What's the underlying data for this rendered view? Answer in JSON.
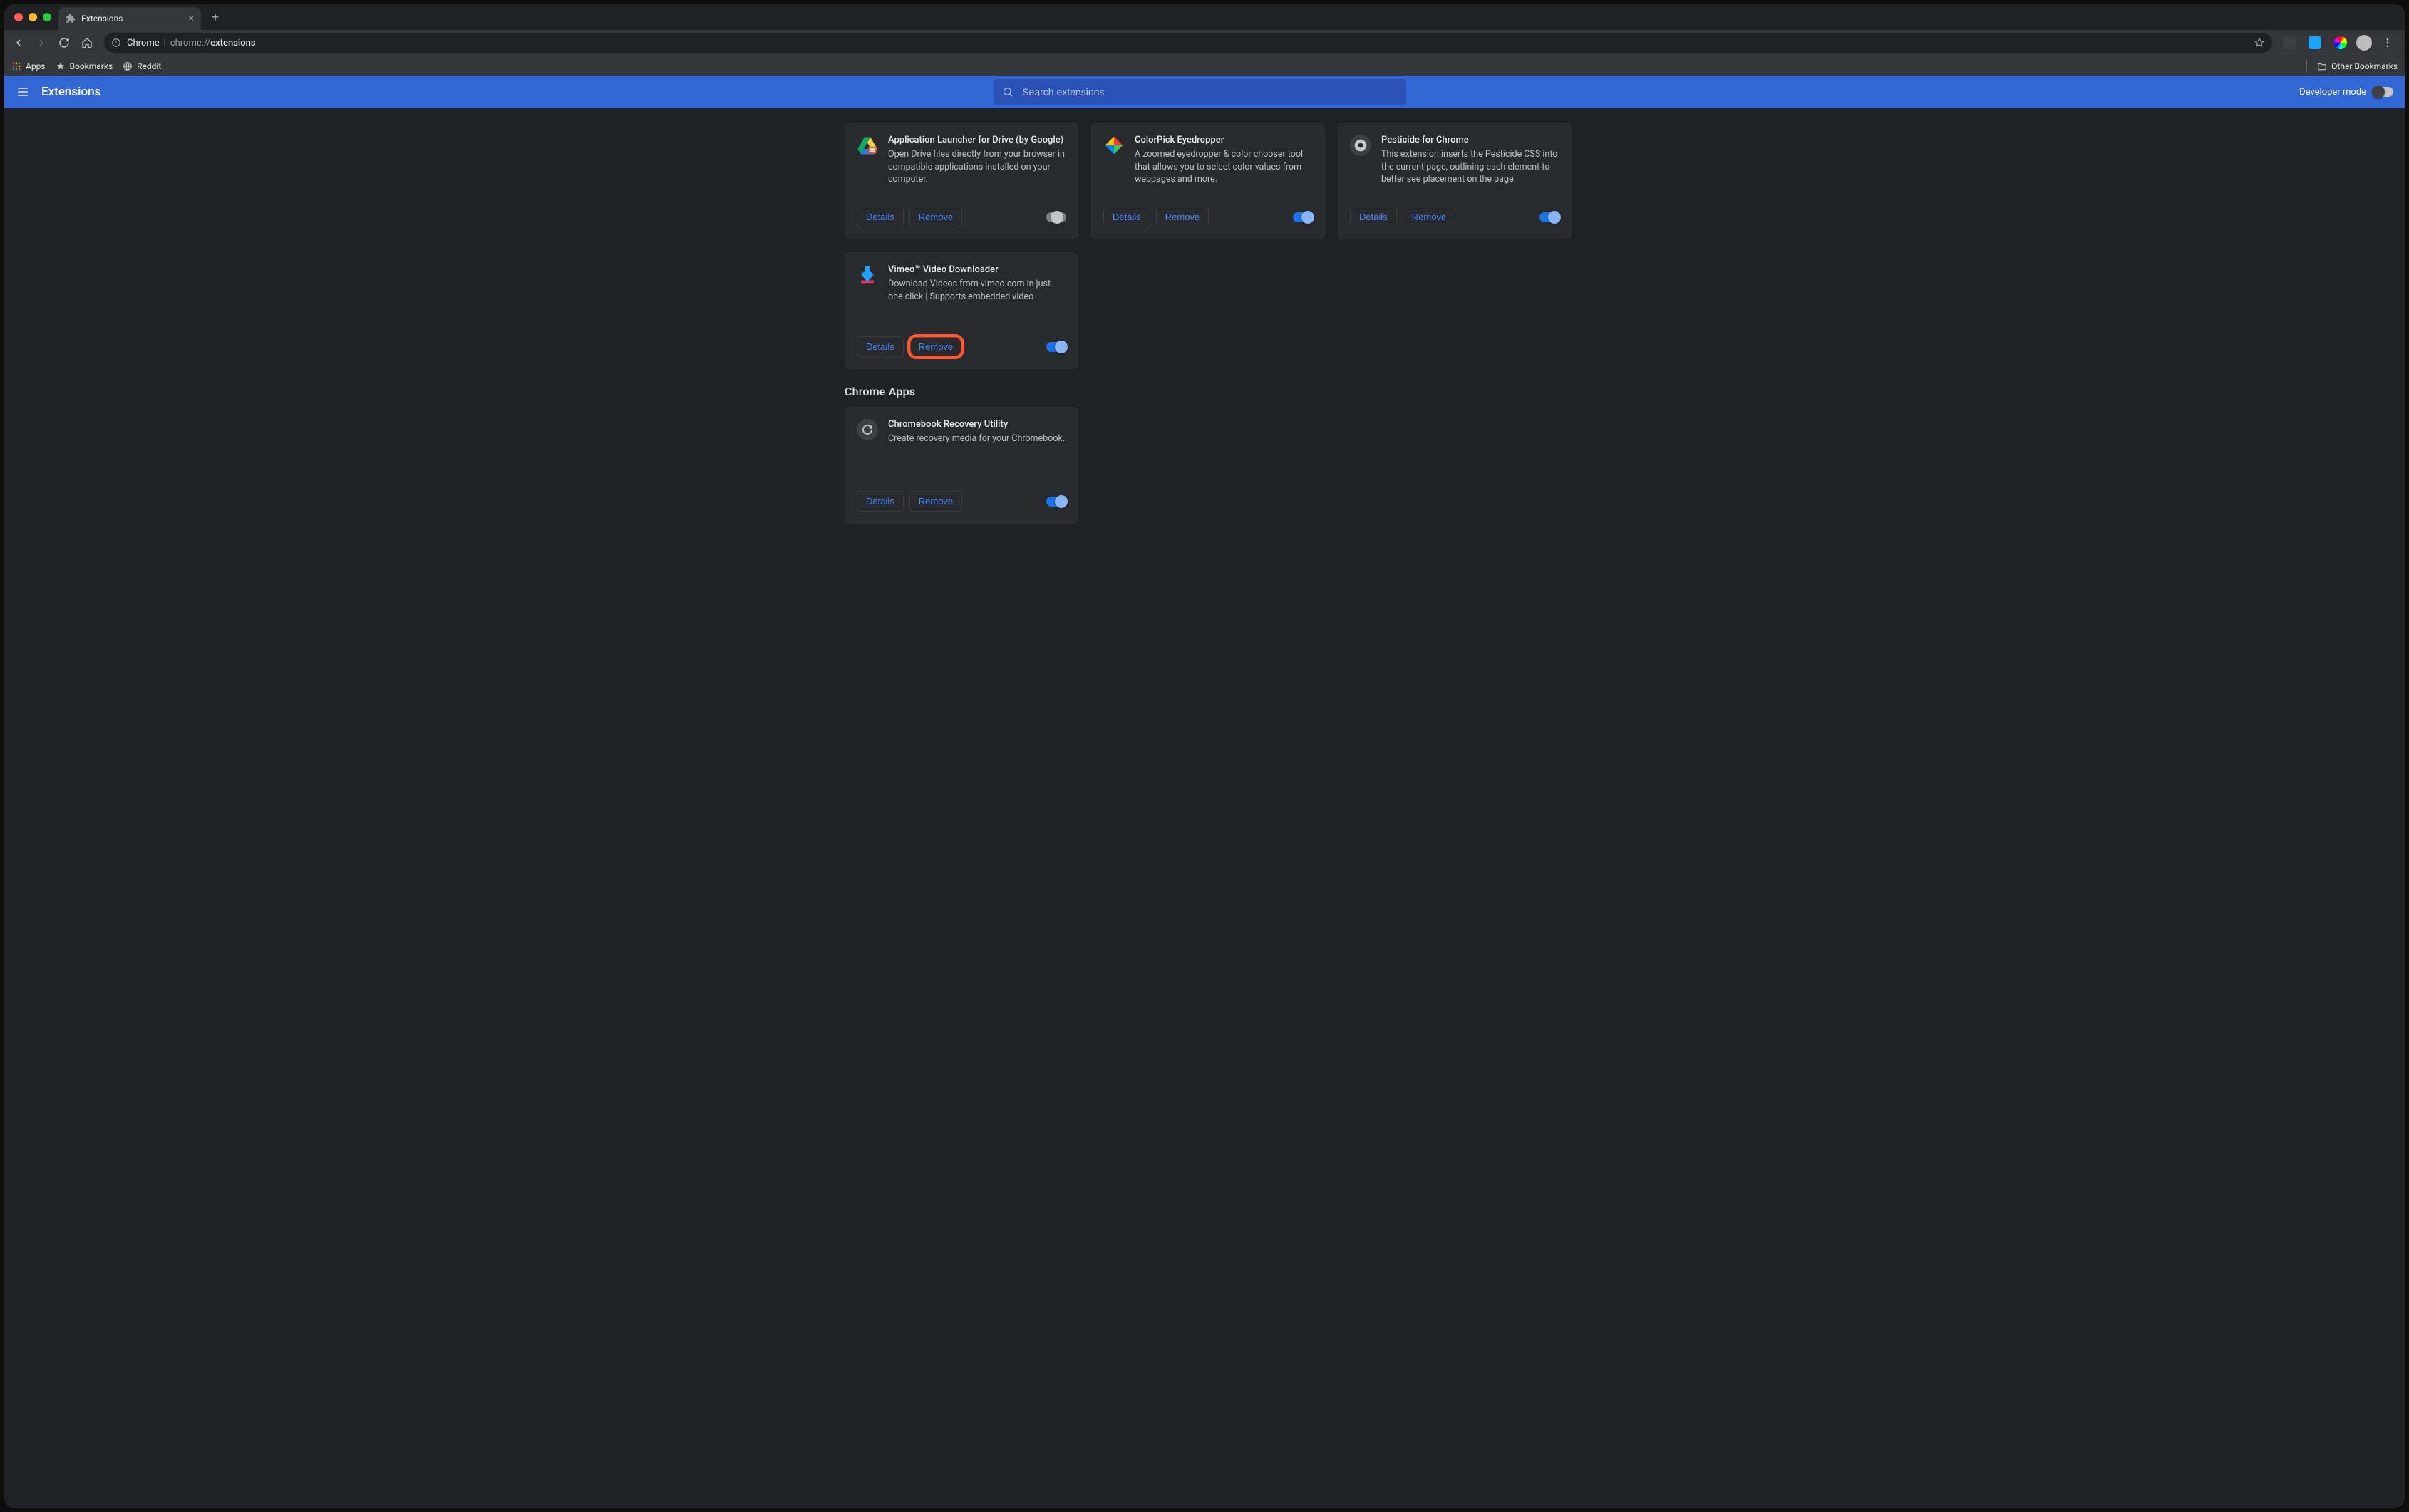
{
  "window": {
    "tab_title": "Extensions"
  },
  "omnibox": {
    "scheme_app": "Chrome",
    "url_prefix": "chrome://",
    "url_highlight": "extensions"
  },
  "bookmarks": {
    "apps": "Apps",
    "bookmarks_folder": "Bookmarks",
    "reddit": "Reddit",
    "other_bookmarks": "Other Bookmarks"
  },
  "header": {
    "title": "Extensions",
    "search_placeholder": "Search extensions",
    "developer_mode_label": "Developer mode"
  },
  "buttons": {
    "details": "Details",
    "remove": "Remove"
  },
  "extensions": [
    {
      "name": "Application Launcher for Drive (by Google)",
      "description": "Open Drive files directly from your browser in compatible applications installed on your computer.",
      "enabled": "half"
    },
    {
      "name": "ColorPick Eyedropper",
      "description": "A zoomed eyedropper & color chooser tool that allows you to select color values from webpages and more.",
      "enabled": true
    },
    {
      "name": "Pesticide for Chrome",
      "description": "This extension inserts the Pesticide CSS into the current page, outlining each element to better see placement on the page.",
      "enabled": true
    },
    {
      "name": "Vimeo™ Video Downloader",
      "description": "Download Videos from vimeo.com in just one click | Supports embedded video",
      "enabled": true,
      "highlight_remove": true
    }
  ],
  "apps_section_title": "Chrome Apps",
  "chrome_apps": [
    {
      "name": "Chromebook Recovery Utility",
      "description": "Create recovery media for your Chromebook.",
      "enabled": true
    }
  ]
}
